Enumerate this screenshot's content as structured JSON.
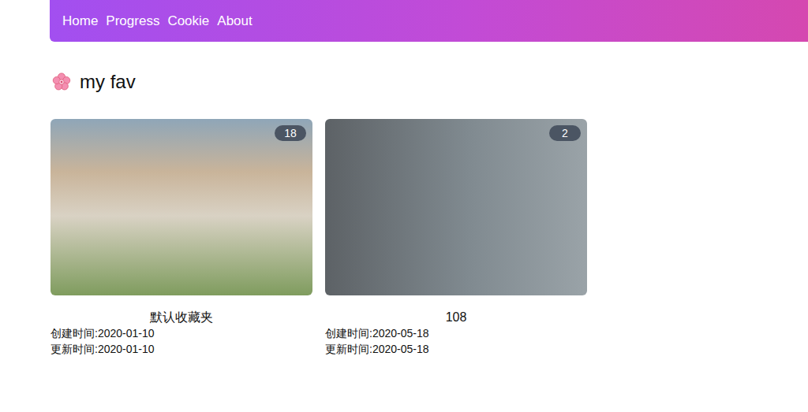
{
  "nav": {
    "links": [
      {
        "label": "Home"
      },
      {
        "label": "Progress"
      },
      {
        "label": "Cookie"
      },
      {
        "label": "About"
      }
    ]
  },
  "heading": {
    "title": "my fav"
  },
  "folders": [
    {
      "title": "默认收藏夹",
      "count": "18",
      "created": "创建时间:2020-01-10",
      "updated": "更新时间:2020-01-10"
    },
    {
      "title": "108",
      "count": "2",
      "created": "创建时间:2020-05-18",
      "updated": "更新时间:2020-05-18"
    }
  ]
}
